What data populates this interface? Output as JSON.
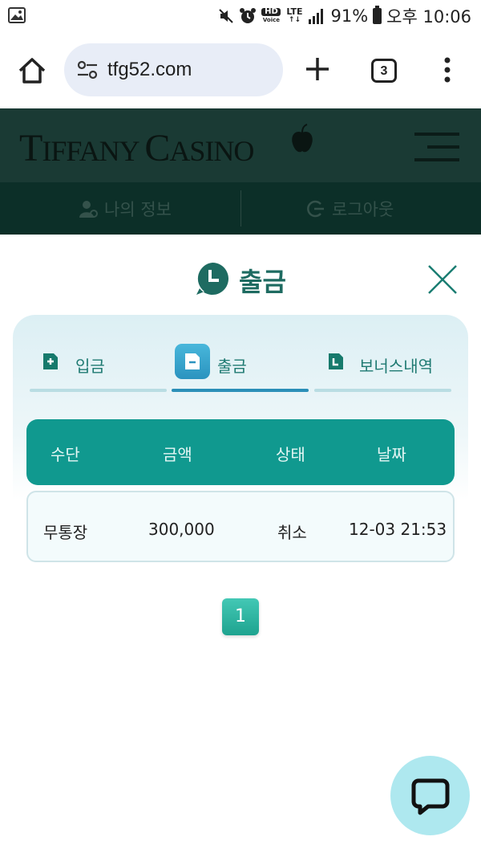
{
  "status_bar": {
    "battery": "91%",
    "time": "오후 10:06",
    "network": "LTE",
    "hd_badge": "HD",
    "voice_badge": "Voice"
  },
  "browser": {
    "url": "tfg52.com",
    "tab_count": "3"
  },
  "site": {
    "logo": {
      "t1": "T",
      "t2": "IFFANY ",
      "t3": "C",
      "t4": "ASINO"
    },
    "nav": {
      "my_info": "나의 정보",
      "logout": "로그아웃"
    }
  },
  "modal": {
    "title": "출금",
    "tabs": [
      {
        "label": "입금",
        "active": false
      },
      {
        "label": "출금",
        "active": true
      },
      {
        "label": "보너스내역",
        "active": false
      }
    ],
    "table": {
      "headers": [
        "수단",
        "금액",
        "상태",
        "날짜"
      ],
      "rows": [
        [
          "무통장",
          "300,000",
          "취소",
          "12-03 21:53"
        ]
      ]
    },
    "pagination": {
      "current": "1"
    }
  },
  "colors": {
    "accent": "#10998f",
    "title": "#1e6b61",
    "header_bg": "#1a3a34",
    "chat_bg": "#aee8ef"
  }
}
